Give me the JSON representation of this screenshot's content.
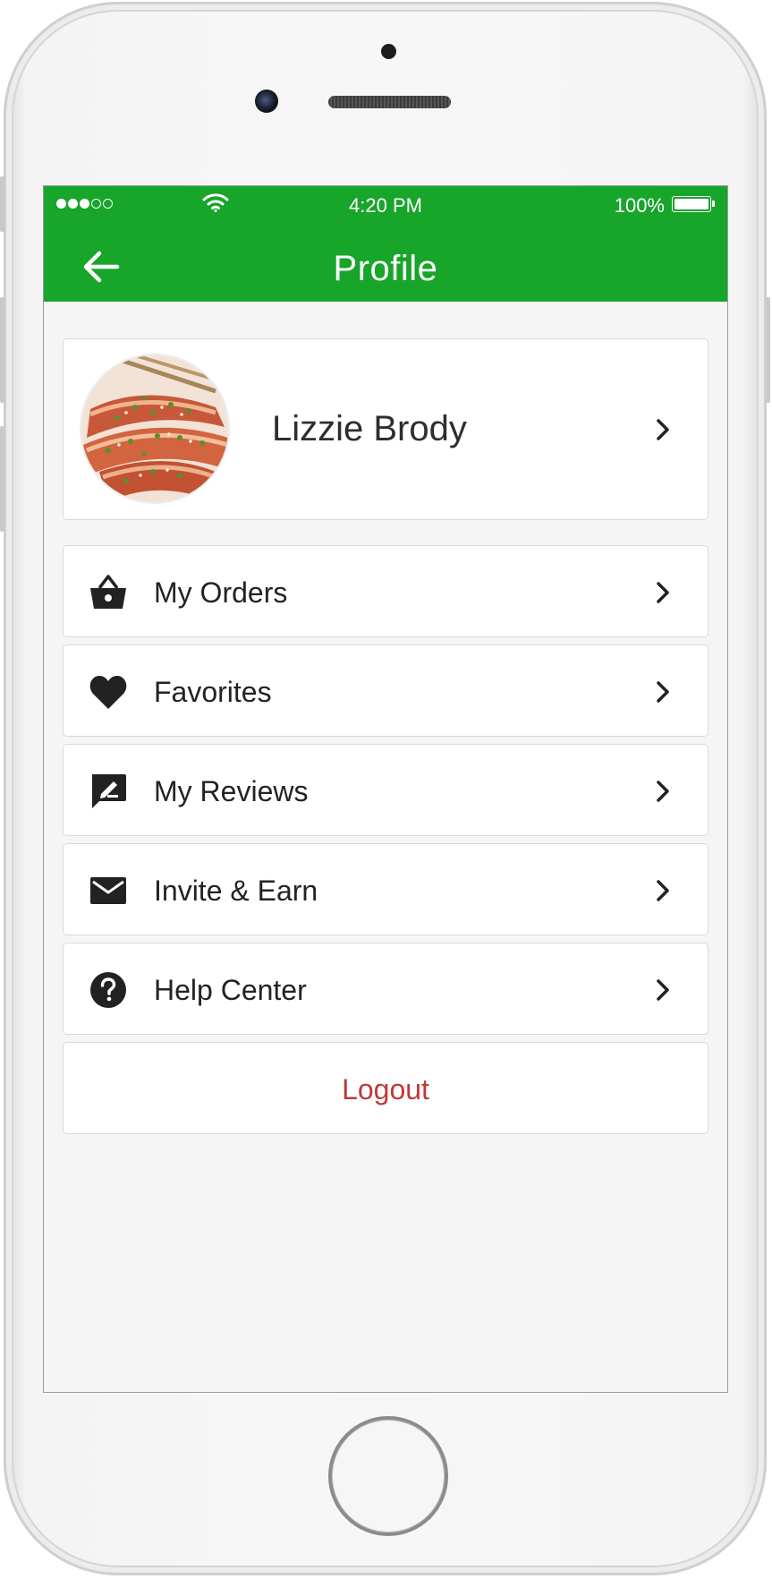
{
  "status_bar": {
    "time": "4:20 PM",
    "battery": "100%",
    "signal_bars_filled": 3,
    "signal_bars_total": 5
  },
  "header": {
    "title": "Profile",
    "back_icon": "arrow-left-icon",
    "background_color": "#17a52a"
  },
  "profile": {
    "name": "Lizzie Brody",
    "avatar": "food-photo-salmon"
  },
  "menu": {
    "items": [
      {
        "label": "My Orders",
        "icon": "basket-icon"
      },
      {
        "label": "Favorites",
        "icon": "heart-icon"
      },
      {
        "label": "My Reviews",
        "icon": "review-icon"
      },
      {
        "label": "Invite & Earn",
        "icon": "envelope-icon"
      },
      {
        "label": "Help Center",
        "icon": "help-icon"
      }
    ],
    "logout_label": "Logout",
    "logout_color": "#c0393b"
  }
}
